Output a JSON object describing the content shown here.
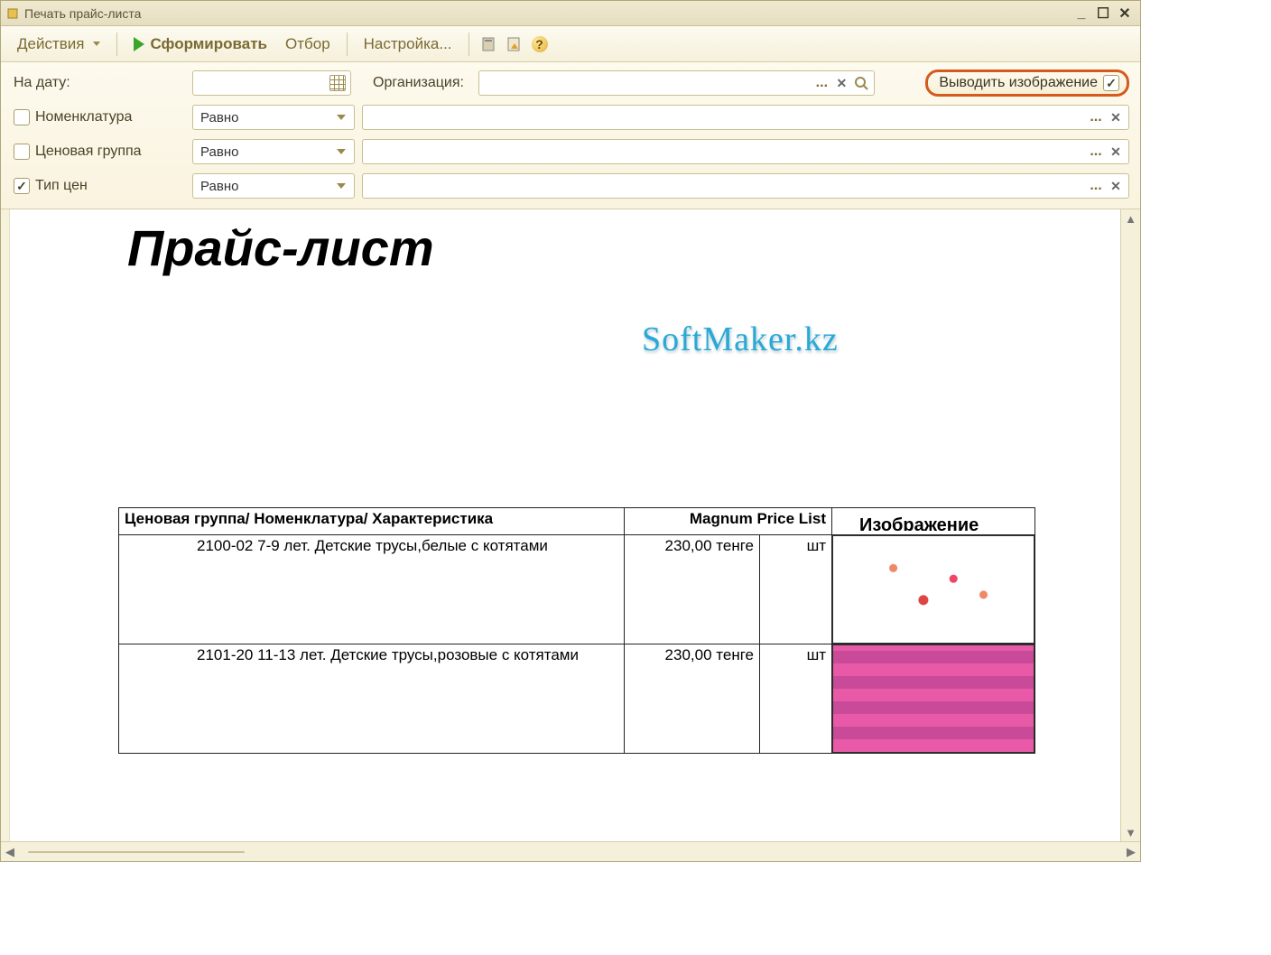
{
  "window": {
    "title": "Печать прайс-листа"
  },
  "toolbar": {
    "actions": "Действия",
    "generate": "Сформировать",
    "selection": "Отбор",
    "settings": "Настройка..."
  },
  "filters": {
    "date_label": "На дату:",
    "date_value": "",
    "org_label": "Организация:",
    "org_value": "",
    "show_image_label": "Выводить изображение",
    "show_image_checked": true,
    "rows": [
      {
        "check": false,
        "label": "Номенклатура",
        "op": "Равно",
        "value": ""
      },
      {
        "check": false,
        "label": "Ценовая группа",
        "op": "Равно",
        "value": ""
      },
      {
        "check": true,
        "label": "Тип цен",
        "op": "Равно",
        "value": ""
      }
    ]
  },
  "report": {
    "title": "Прайс-лист",
    "watermark": "SoftMaker.kz",
    "headers": {
      "name": "Ценовая группа/ Номенклатура/ Характеристика",
      "price": "Magnum Price List",
      "image": "Изображение"
    },
    "rows": [
      {
        "name": "2100-02 7-9 лет. Детские трусы,белые с котятами",
        "price": "230,00",
        "currency": "тенге",
        "unit": "шт"
      },
      {
        "name": "2101-20 11-13 лет. Детские трусы,розовые с котятами",
        "price": "230,00",
        "currency": "тенге",
        "unit": "шт"
      }
    ]
  }
}
